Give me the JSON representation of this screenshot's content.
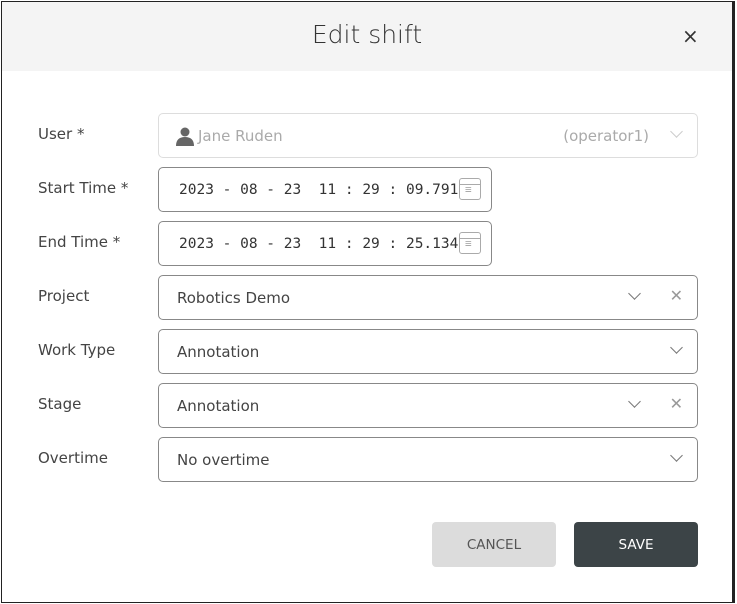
{
  "dialog": {
    "title": "Edit shift",
    "close_icon": "×"
  },
  "fields": {
    "user": {
      "label": "User *",
      "value": "Jane Ruden",
      "username": "(operator1)"
    },
    "start": {
      "label": "Start Time *",
      "value": "2023 - 08 - 23  11 : 29 : 09.791"
    },
    "end": {
      "label": "End Time *",
      "value": "2023 - 08 - 23  11 : 29 : 25.134"
    },
    "project": {
      "label": "Project",
      "value": "Robotics Demo"
    },
    "work_type": {
      "label": "Work Type",
      "value": "Annotation"
    },
    "stage": {
      "label": "Stage",
      "value": "Annotation"
    },
    "overtime": {
      "label": "Overtime",
      "value": "No overtime"
    }
  },
  "buttons": {
    "cancel": "CANCEL",
    "save": "SAVE"
  }
}
